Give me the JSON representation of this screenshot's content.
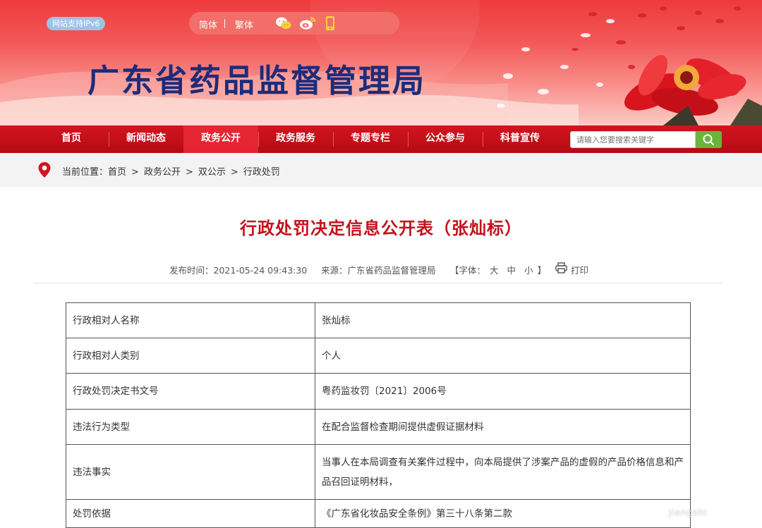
{
  "header": {
    "ipv6_badge": "网站支持IPv6",
    "lang_simplified": "简体",
    "lang_traditional": "繁体",
    "site_title": "广东省药品监督管理局"
  },
  "nav": {
    "items": [
      "首页",
      "新闻动态",
      "政务公开",
      "政务服务",
      "专题专栏",
      "公众参与",
      "科普宣传"
    ],
    "active_index": 2,
    "search_placeholder": "请输入您要搜索关键字"
  },
  "breadcrumb": {
    "prefix": "当前位置：",
    "items": [
      "首页",
      "政务公开",
      "双公示",
      "行政处罚"
    ],
    "separator": ">"
  },
  "article": {
    "title": "行政处罚决定信息公开表（张灿标）",
    "publish_time": "发布时间：2021-05-24 09:43:30",
    "source": "来源：广东省药品监督管理局",
    "font_label": "【字体：",
    "font_large": "大",
    "font_medium": "中",
    "font_small": "小",
    "font_close": "】",
    "print_label": "打印"
  },
  "table": {
    "rows": [
      {
        "label": "行政相对人名称",
        "value": "张灿标"
      },
      {
        "label": "行政相对人类别",
        "value": "个人"
      },
      {
        "label": "行政处罚决定书文号",
        "value": "粤药监妆罚〔2021〕2006号"
      },
      {
        "label": "违法行为类型",
        "value": "在配合监督检查期间提供虚假证据材料"
      },
      {
        "label": "违法事实",
        "value": "当事人在本局调查有关案件过程中，向本局提供了涉案产品的虚假的产品价格信息和产品召回证明材料，"
      },
      {
        "label": "处罚依据",
        "value": "《广东省化妆品安全条例》第三十八条第二款"
      }
    ]
  },
  "watermark": "jiangshi",
  "colors": {
    "nav_red": "#c2101a",
    "title_red": "#c4121c",
    "site_title_blue": "#1c2c7a",
    "search_green": "#69b53a"
  },
  "icons": [
    "wechat-icon",
    "weibo-icon",
    "mobile-icon",
    "search-icon",
    "location-pin-icon",
    "printer-icon"
  ]
}
